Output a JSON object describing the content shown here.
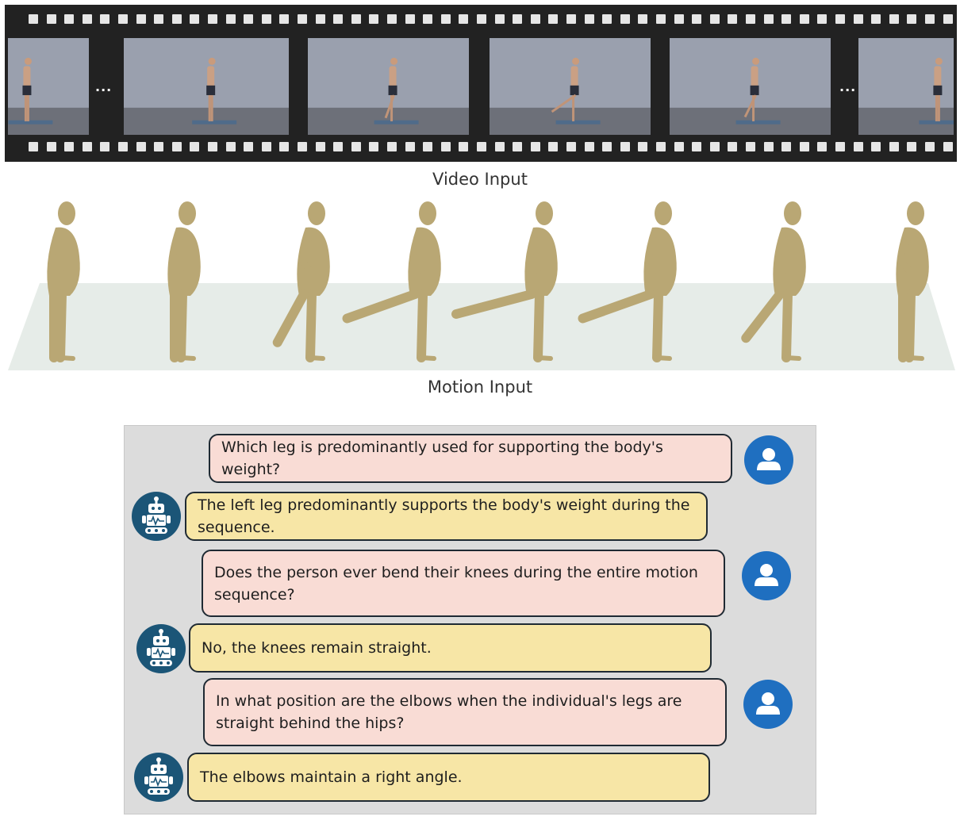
{
  "captions": {
    "video": "Video Input",
    "motion": "Motion Input"
  },
  "film": {
    "ellipsis_left": "...",
    "ellipsis_right": "..."
  },
  "icons": {
    "user": "user-avatar-icon",
    "assistant": "robot-avatar-icon"
  },
  "colors": {
    "film_bg": "#222222",
    "user_bubble": "#f9dcd5",
    "bot_bubble": "#f7e6a6",
    "user_avatar": "#1f6fc0",
    "bot_avatar": "#1b5577",
    "chat_panel": "#dcdcdc",
    "body_mesh": "#b9a774"
  },
  "conversation": [
    {
      "role": "user",
      "text": "Which leg is predominantly used for supporting the body's weight?"
    },
    {
      "role": "assistant",
      "text": "The left leg predominantly supports the body's weight during the sequence."
    },
    {
      "role": "user",
      "text": "Does the person ever bend their knees during the entire motion sequence?"
    },
    {
      "role": "assistant",
      "text": "No, the knees remain straight."
    },
    {
      "role": "user",
      "text": "In what position are the elbows when the individual's legs are straight behind the hips?"
    },
    {
      "role": "assistant",
      "text": "The elbows maintain a right angle."
    }
  ]
}
